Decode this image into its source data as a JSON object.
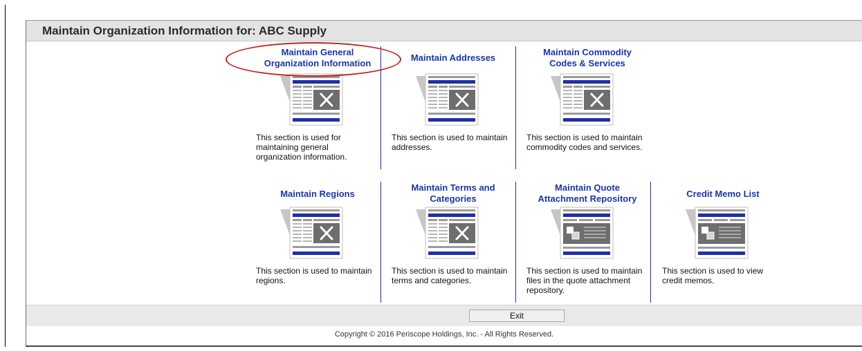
{
  "page": {
    "title": "Maintain Organization Information for: ABC Supply",
    "copyright": "Copyright © 2016 Periscope Holdings, Inc. - All Rights Reserved.",
    "exit_label": "Exit"
  },
  "tiles": [
    {
      "title_line1": "Maintain General",
      "title_line2": "Organization Information",
      "icon": "settings-form-icon",
      "desc_line1": "This section is used for",
      "desc_line2": "maintaining general",
      "desc_line3": "organization information."
    },
    {
      "title_line1": "Maintain Addresses",
      "title_line2": "",
      "icon": "settings-form-icon",
      "desc_line1": "This section is used to maintain",
      "desc_line2": "addresses.",
      "desc_line3": ""
    },
    {
      "title_line1": "Maintain Commodity",
      "title_line2": "Codes & Services",
      "icon": "settings-form-icon",
      "desc_line1": "This section is used to maintain",
      "desc_line2": "commodity codes and services.",
      "desc_line3": ""
    },
    {
      "title_line1": "Maintain Regions",
      "title_line2": "",
      "icon": "settings-form-icon",
      "desc_line1": "This section is used to maintain",
      "desc_line2": "regions.",
      "desc_line3": ""
    },
    {
      "title_line1": "Maintain Terms and",
      "title_line2": "Categories",
      "icon": "settings-form-icon",
      "desc_line1": "This section is used to maintain",
      "desc_line2": "terms and categories.",
      "desc_line3": ""
    },
    {
      "title_line1": "Maintain Quote",
      "title_line2": "Attachment Repository",
      "icon": "document-repository-icon",
      "desc_line1": "This section is used to maintain",
      "desc_line2": "files in the quote attachment",
      "desc_line3": "repository."
    },
    {
      "title_line1": "Credit Memo List",
      "title_line2": "",
      "icon": "document-repository-icon",
      "desc_line1": "This section is used to view",
      "desc_line2": "credit memos.",
      "desc_line3": ""
    }
  ],
  "colors": {
    "title_link": "#1a35a8",
    "divider": "#1f2f9a",
    "highlight": "#c42020",
    "icon_blue": "#1f2fa8",
    "icon_gray": "#8a8a8a"
  }
}
